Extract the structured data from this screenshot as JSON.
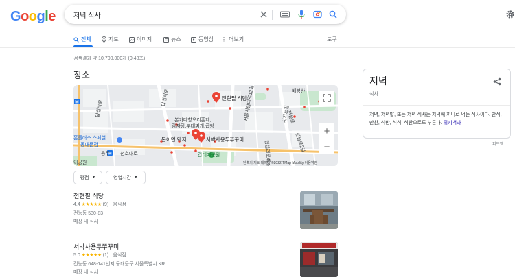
{
  "logo": {
    "letters": [
      "G",
      "o",
      "o",
      "g",
      "l",
      "e"
    ],
    "colors": [
      "#4285f4",
      "#ea4335",
      "#fbbc05",
      "#4285f4",
      "#34a853",
      "#ea4335"
    ]
  },
  "search": {
    "query": "저녁 식사"
  },
  "icons": {
    "clear": "close-icon",
    "keyboard": "keyboard-icon",
    "voice": "mic-icon",
    "lens": "camera-icon",
    "search": "search-icon",
    "settings": "gear-icon"
  },
  "tabs": [
    {
      "label": "전체",
      "icon": "search-icon",
      "active": true
    },
    {
      "label": "지도",
      "icon": "pin-icon"
    },
    {
      "label": "이미지",
      "icon": "image-icon"
    },
    {
      "label": "뉴스",
      "icon": "news-icon"
    },
    {
      "label": "동영상",
      "icon": "play-icon"
    },
    {
      "label": "더보기",
      "icon": "more-icon"
    }
  ],
  "tools_label": "도구",
  "result_stats": "검색결과 약 10,700,000개 (0.48초)",
  "places": {
    "title": "장소",
    "map": {
      "labels": {
        "l1": "전현필 식당",
        "l2": "본가다향오리훈제,",
        "l3": "감자탕,부대찌개,곱창",
        "l4": "돈이면 돼지",
        "l5": "서박사용두쭈꾸미",
        "l6": "간데메공원",
        "l7": "서울시립대로12길",
        "l8": "홈플러스 스페셜",
        "l9": "동대문점",
        "l10": "배봉산",
        "l11": "시기로길",
        "l12": "전농로",
        "l13": "답십리로",
        "l14": "답십리로",
        "l15": "전농로2길",
        "l16": "이공원",
        "l17": "천호대로",
        "l18": "용두",
        "l19": "답십리로45길"
      },
      "attribution": "단축키   지도 데이터 ©2022 TMap Mobility   이용약관"
    },
    "chips": [
      "평점",
      "영업시간"
    ],
    "listings": [
      {
        "name": "전현필 식당",
        "rating": "4.4",
        "stars": "★★★★★",
        "reviews": "(9)",
        "category": "· 음식점",
        "address": "전농동 530-83",
        "service": "매장 내 식사"
      },
      {
        "name": "서박사용두쭈꾸미",
        "rating": "5.0",
        "stars": "★★★★★",
        "reviews": "(1)",
        "category": "· 음식점",
        "address": "전농동 648-141번지 동대문구 서울특별시 KR",
        "service": "매장 내 식사"
      }
    ]
  },
  "knowledge_panel": {
    "title": "저녁",
    "subtitle": "식사",
    "description": "저녁, 저녁밥, 또는 저녁 식사는 저녁에 끼니로 먹는 식사이다. 만식, 만찬, 석반, 석식, 석찬으로도 부른다.",
    "link": "위키백과"
  },
  "feedback": "피드백",
  "colors": {
    "accent": "#1a73e8",
    "star": "#f8b400",
    "pin": "#ea4335",
    "link": "#1a0dab"
  }
}
